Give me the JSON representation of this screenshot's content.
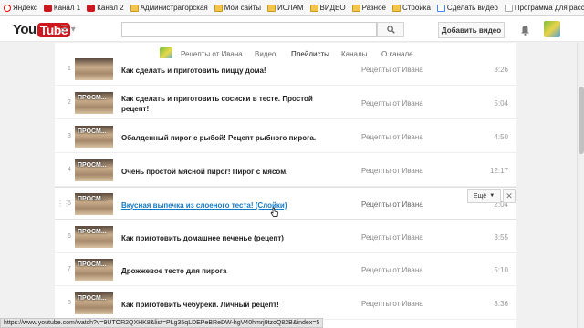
{
  "bookmarks": [
    {
      "label": "Яндекс",
      "icon": "yandex-icon",
      "kind": "yandex"
    },
    {
      "label": "Канал 1",
      "icon": "youtube-icon",
      "kind": "yt"
    },
    {
      "label": "Канал 2",
      "icon": "youtube-icon",
      "kind": "yt"
    },
    {
      "label": "Администраторская",
      "icon": "folder-icon",
      "kind": "folder"
    },
    {
      "label": "Мои сайты",
      "icon": "folder-icon",
      "kind": "folder"
    },
    {
      "label": "ИСЛАМ",
      "icon": "folder-icon",
      "kind": "folder"
    },
    {
      "label": "ВИДЕО",
      "icon": "folder-icon",
      "kind": "folder"
    },
    {
      "label": "Разное",
      "icon": "folder-icon",
      "kind": "folder"
    },
    {
      "label": "Стройка",
      "icon": "folder-icon",
      "kind": "folder"
    },
    {
      "label": "Сделать видео",
      "icon": "google-icon",
      "kind": "google"
    },
    {
      "label": "Программа для расс...",
      "icon": "page-icon",
      "kind": "page"
    }
  ],
  "header": {
    "logo_you": "You",
    "logo_tube": "Tube",
    "upload_label": "Добавить видео"
  },
  "channel_nav": {
    "tabs": [
      {
        "label": "Рецепты от Ивана",
        "active": false
      },
      {
        "label": "Видео",
        "active": false
      },
      {
        "label": "Плейлисты",
        "active": true
      },
      {
        "label": "Каналы",
        "active": false
      },
      {
        "label": "О канале",
        "active": false
      }
    ]
  },
  "playlist": {
    "rows": [
      {
        "index": "1",
        "thumb_text": "",
        "title": "Как сделать и приготовить пиццу дома!",
        "owner": "Рецепты от Ивана",
        "duration": "8:26"
      },
      {
        "index": "2",
        "thumb_text": "ПРОСМ...",
        "title": "Как сделать и приготовить сосиски в тесте. Простой рецепт!",
        "owner": "Рецепты от Ивана",
        "duration": "5:04"
      },
      {
        "index": "3",
        "thumb_text": "ПРОСМ...",
        "title": "Обалденный пирог с рыбой! Рецепт рыбного пирога.",
        "owner": "Рецепты от Ивана",
        "duration": "4:50"
      },
      {
        "index": "4",
        "thumb_text": "ПРОСМ...",
        "title": "Очень простой мясной пирог! Пирог с мясом.",
        "owner": "Рецепты от Ивана",
        "duration": "12:17"
      },
      {
        "index": "5",
        "thumb_text": "ПРОСМ...",
        "title": "Вкусная выпечка из слоеного теста! (Слойки)",
        "owner": "Рецепты от Ивана",
        "duration": "2:04",
        "hover": true
      },
      {
        "index": "6",
        "thumb_text": "ПРОСМ...",
        "title": "Как приготовить домашнее печенье (рецепт)",
        "owner": "Рецепты от Ивана",
        "duration": "3:55"
      },
      {
        "index": "7",
        "thumb_text": "ПРОСМ...",
        "title": "Дрожжевое тесто для пирога",
        "owner": "Рецепты от Ивана",
        "duration": "5:10"
      },
      {
        "index": "8",
        "thumb_text": "ПРОСМ...",
        "title": "Как приготовить чебуреки. Личный рецепт!",
        "owner": "Рецепты от Ивана",
        "duration": "3:36"
      }
    ],
    "more_label": "Ещё",
    "remove_label": "✕"
  },
  "status_url": "https://www.youtube.com/watch?v=9UTOR2QXHK8&list=PLg35qLDEPeBReDW-hgV40hmrj9tzoQ82B&index=5",
  "colors": {
    "brand": "#cc181e",
    "link": "#167ac6"
  }
}
